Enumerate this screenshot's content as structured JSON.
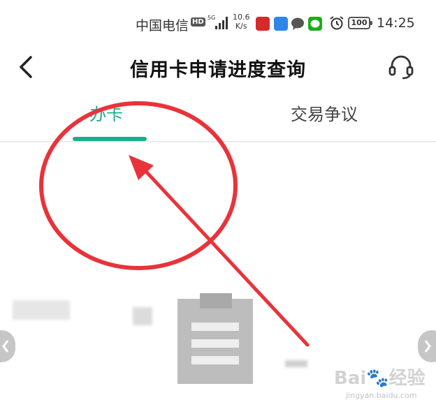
{
  "status_bar": {
    "carrier": "中国电信",
    "hd_badge": "HD",
    "network": "5G",
    "speed_value": "10.6",
    "speed_unit": "K/s",
    "battery": "100",
    "time": "14:25"
  },
  "header": {
    "title": "信用卡申请进度查询"
  },
  "tabs": [
    {
      "label": "办卡",
      "active": true
    },
    {
      "label": "交易争议",
      "active": false
    }
  ],
  "colors": {
    "accent": "#1aae8c",
    "annotation": "#e8333a"
  },
  "watermark": {
    "brand": "Bai",
    "brand_sub": "经验",
    "url": "jingyan.baidu.com"
  }
}
